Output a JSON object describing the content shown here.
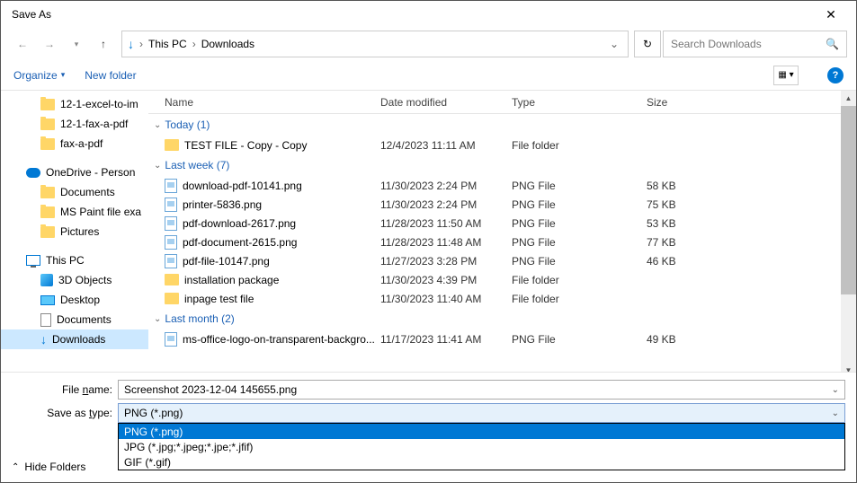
{
  "title": "Save As",
  "breadcrumb": {
    "root": "This PC",
    "current": "Downloads"
  },
  "search": {
    "placeholder": "Search Downloads"
  },
  "toolbar": {
    "organize": "Organize",
    "newfolder": "New folder"
  },
  "tree": {
    "quick": [
      "12-1-excel-to-im",
      "12-1-fax-a-pdf",
      "fax-a-pdf"
    ],
    "onedrive": "OneDrive - Person",
    "onedrive_items": [
      "Documents",
      "MS Paint file exa",
      "Pictures"
    ],
    "thispc": "This PC",
    "thispc_items": [
      "3D Objects",
      "Desktop",
      "Documents",
      "Downloads"
    ]
  },
  "columns": {
    "name": "Name",
    "date": "Date modified",
    "type": "Type",
    "size": "Size"
  },
  "groups": [
    {
      "label": "Today (1)",
      "rows": [
        {
          "name": "TEST FILE - Copy - Copy",
          "date": "12/4/2023 11:11 AM",
          "type": "File folder",
          "size": "",
          "icon": "folder"
        }
      ]
    },
    {
      "label": "Last week (7)",
      "rows": [
        {
          "name": "download-pdf-10141.png",
          "date": "11/30/2023 2:24 PM",
          "type": "PNG File",
          "size": "58 KB",
          "icon": "file"
        },
        {
          "name": "printer-5836.png",
          "date": "11/30/2023 2:24 PM",
          "type": "PNG File",
          "size": "75 KB",
          "icon": "file"
        },
        {
          "name": "pdf-download-2617.png",
          "date": "11/28/2023 11:50 AM",
          "type": "PNG File",
          "size": "53 KB",
          "icon": "file"
        },
        {
          "name": "pdf-document-2615.png",
          "date": "11/28/2023 11:48 AM",
          "type": "PNG File",
          "size": "77 KB",
          "icon": "file"
        },
        {
          "name": "pdf-file-10147.png",
          "date": "11/27/2023 3:28 PM",
          "type": "PNG File",
          "size": "46 KB",
          "icon": "file"
        },
        {
          "name": "installation package",
          "date": "11/30/2023 4:39 PM",
          "type": "File folder",
          "size": "",
          "icon": "folder"
        },
        {
          "name": "inpage test file",
          "date": "11/30/2023 11:40 AM",
          "type": "File folder",
          "size": "",
          "icon": "folder"
        }
      ]
    },
    {
      "label": "Last month (2)",
      "rows": [
        {
          "name": "ms-office-logo-on-transparent-backgro...",
          "date": "11/17/2023 11:41 AM",
          "type": "PNG File",
          "size": "49 KB",
          "icon": "file"
        }
      ]
    }
  ],
  "filename": {
    "label": "File name:",
    "value": "Screenshot 2023-12-04 145655.png"
  },
  "saveastype": {
    "label": "Save as type:",
    "value": "PNG (*.png)"
  },
  "type_options": [
    "PNG (*.png)",
    "JPG (*.jpg;*.jpeg;*.jpe;*.jfif)",
    "GIF (*.gif)"
  ],
  "hide_folders": "Hide Folders"
}
